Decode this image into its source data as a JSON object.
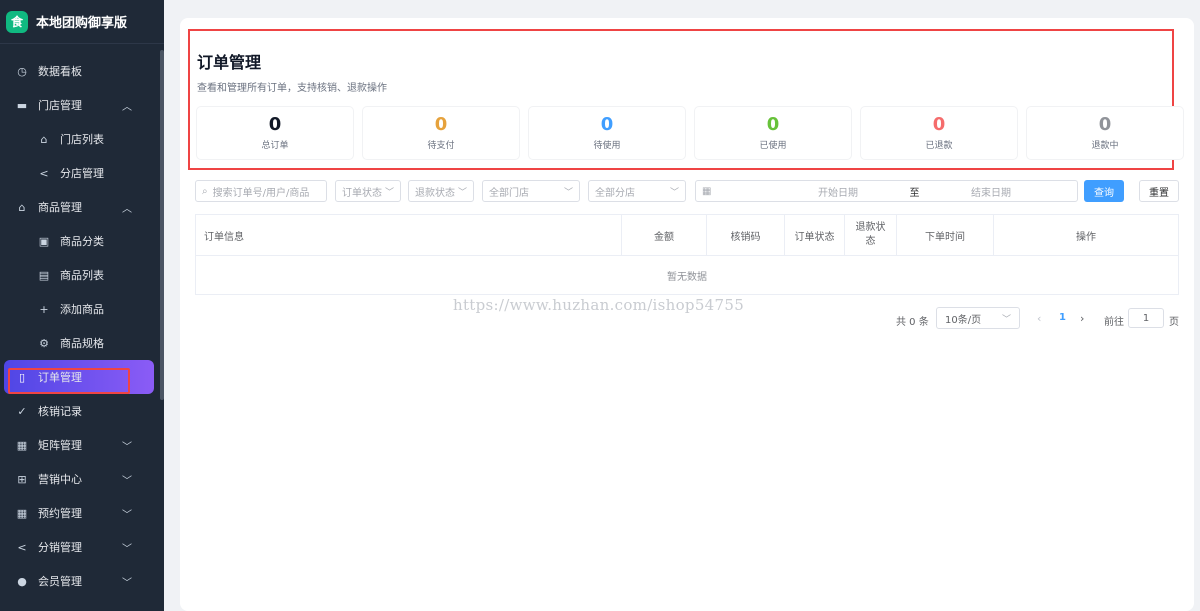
{
  "app": {
    "title": "本地团购御享版",
    "logo_glyph": "食"
  },
  "sidebar": {
    "items": [
      {
        "label": "数据看板",
        "icon": "dashboard-icon",
        "glyph": "◷"
      },
      {
        "label": "门店管理",
        "icon": "store-icon",
        "glyph": "▬",
        "chevron": "︿"
      },
      {
        "label": "门店列表",
        "icon": "home-icon",
        "glyph": "⌂"
      },
      {
        "label": "分店管理",
        "icon": "share-icon",
        "glyph": "<"
      },
      {
        "label": "商品管理",
        "icon": "bag-icon",
        "glyph": "⌂",
        "chevron": "︿"
      },
      {
        "label": "商品分类",
        "icon": "category-icon",
        "glyph": "▣"
      },
      {
        "label": "商品列表",
        "icon": "clipboard-icon",
        "glyph": "▤"
      },
      {
        "label": "添加商品",
        "icon": "plus-icon",
        "glyph": "+"
      },
      {
        "label": "商品规格",
        "icon": "gear-icon",
        "glyph": "⚙"
      },
      {
        "label": "订单管理",
        "icon": "document-icon",
        "glyph": "▯"
      },
      {
        "label": "核销记录",
        "icon": "checklist-icon",
        "glyph": "✓"
      },
      {
        "label": "矩阵管理",
        "icon": "grid-icon",
        "glyph": "▦",
        "chevron": "﹀"
      },
      {
        "label": "营销中心",
        "icon": "gift-icon",
        "glyph": "⊞",
        "chevron": "﹀"
      },
      {
        "label": "预约管理",
        "icon": "calendar-icon",
        "glyph": "▦",
        "chevron": "﹀"
      },
      {
        "label": "分销管理",
        "icon": "share-icon",
        "glyph": "<",
        "chevron": "﹀"
      },
      {
        "label": "会员管理",
        "icon": "user-icon",
        "glyph": "●",
        "chevron": "﹀"
      }
    ]
  },
  "header": {
    "title": "订单管理",
    "description": "查看和管理所有订单，支持核销、退款操作"
  },
  "stats": [
    {
      "value": "0",
      "label": "总订单",
      "color": "#111827"
    },
    {
      "value": "0",
      "label": "待支付",
      "color": "#e6a23c"
    },
    {
      "value": "0",
      "label": "待使用",
      "color": "#409eff"
    },
    {
      "value": "0",
      "label": "已使用",
      "color": "#67c23a"
    },
    {
      "value": "0",
      "label": "已退款",
      "color": "#f56c6c"
    },
    {
      "value": "0",
      "label": "退款中",
      "color": "#909399"
    }
  ],
  "filters": {
    "search_placeholder": "搜索订单号/用户/商品",
    "order_status": "订单状态",
    "refund_status": "退款状态",
    "store": "全部门店",
    "branch": "全部分店",
    "start_date": "开始日期",
    "date_separator": "至",
    "end_date": "结束日期",
    "query_label": "查询",
    "reset_label": "重置"
  },
  "table": {
    "columns": [
      "订单信息",
      "金额",
      "核销码",
      "订单状态",
      "退款状态",
      "下单时间",
      "操作"
    ],
    "empty_text": "暂无数据"
  },
  "watermark": "https://www.huzhan.com/ishop54755",
  "pagination": {
    "total_text": "共 0 条",
    "page_size": "10条/页",
    "current_page": "1",
    "goto_label": "前往",
    "goto_value": "1",
    "page_suffix": "页"
  }
}
